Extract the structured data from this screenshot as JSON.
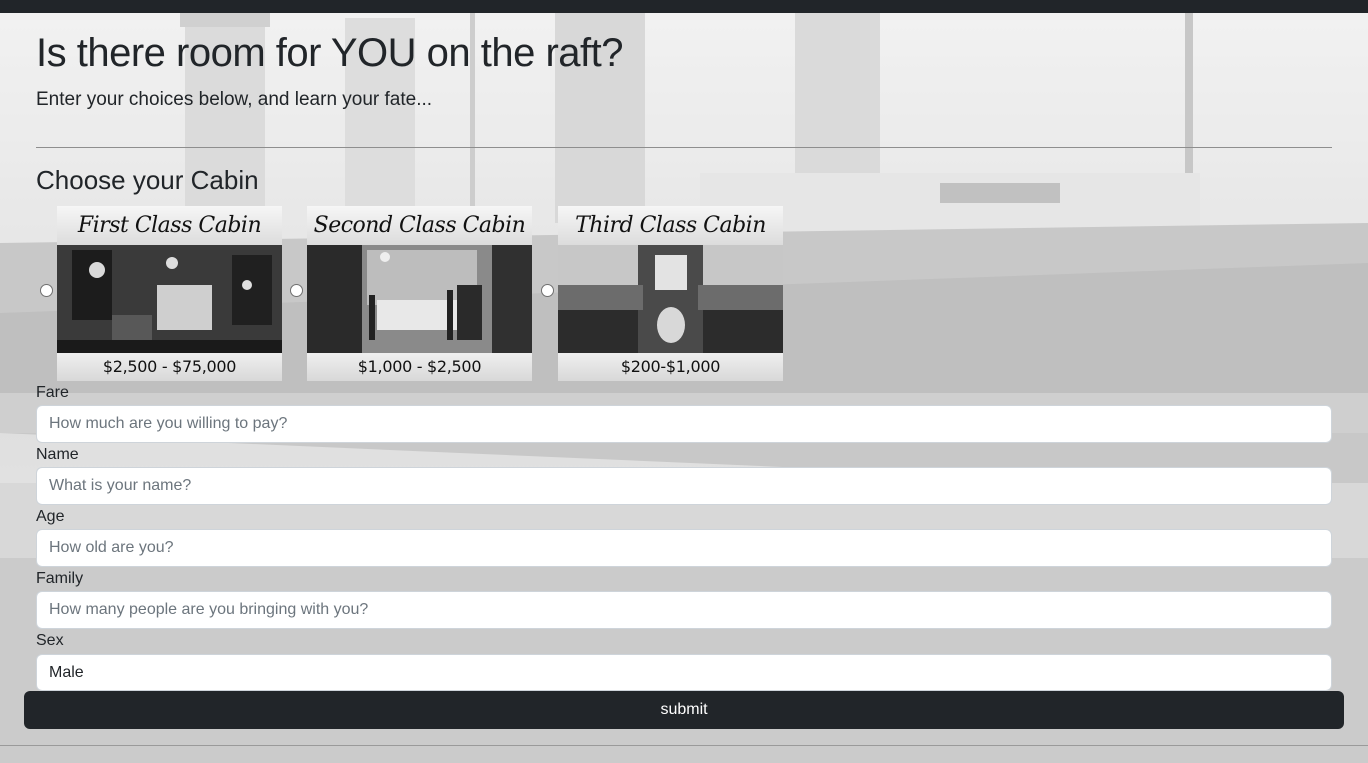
{
  "header": {
    "title": "Is there room for YOU on the raft?",
    "subtitle": "Enter your choices below, and learn your fate..."
  },
  "cabins": {
    "heading": "Choose your Cabin",
    "options": [
      {
        "title": "First Class Cabin",
        "price": "$2,500 - $75,000",
        "selected": false
      },
      {
        "title": "Second Class Cabin",
        "price": "$1,000 - $2,500",
        "selected": false
      },
      {
        "title": "Third Class Cabin",
        "price": "$200-$1,000",
        "selected": false
      }
    ]
  },
  "form": {
    "fare": {
      "label": "Fare",
      "placeholder": "How much are you willing to pay?"
    },
    "name": {
      "label": "Name",
      "placeholder": "What is your name?"
    },
    "age": {
      "label": "Age",
      "placeholder": "How old are you?"
    },
    "family": {
      "label": "Family",
      "placeholder": "How many people are you bringing with you?"
    },
    "sex": {
      "label": "Sex",
      "value": "Male"
    },
    "submit_label": "submit"
  }
}
